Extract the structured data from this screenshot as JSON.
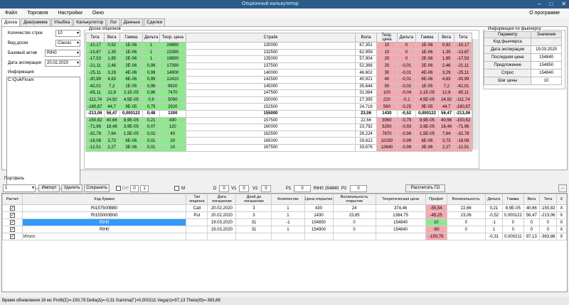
{
  "window": {
    "title": "Опционный калькулятор"
  },
  "menu": [
    "Файл",
    "Торговля",
    "Настройки",
    "Окно"
  ],
  "about": "О программе",
  "tabs": [
    "Доска",
    "Диаграмма",
    "Улыбка",
    "Калькулятор",
    "Лог",
    "Данные",
    "Сделки"
  ],
  "left": {
    "rows_label": "Количество строк",
    "rows_value": "10",
    "view_label": "Вид доски",
    "view_value": "Classic",
    "asset_label": "Базовый актив",
    "asset_value": "RIH0",
    "exp_label": "Дата экспирации",
    "exp_value": "20.02.2020",
    "info_label": "Информация",
    "info_text": "C:\\QuikFinam"
  },
  "board": {
    "title": "Доска опционов",
    "headers": [
      "Тета",
      "Вега",
      "Гамма",
      "Дельта",
      "Теор. цена",
      "Страйк",
      "Вола",
      "Теор. цена",
      "Дельта",
      "Гамма",
      "Вега",
      "Тета"
    ],
    "rows": [
      [
        "-10,17",
        "0,92",
        "1E-06",
        "1",
        "24880",
        "130000",
        "67,351",
        "10",
        "0",
        "1E-06",
        "0,92",
        "-10,17"
      ],
      [
        "-13,87",
        "1,35",
        "1E-06",
        "1",
        "22380",
        "132500",
        "62,959",
        "10",
        "0",
        "1E-06",
        "1,35",
        "-13,87"
      ],
      [
        "-17,53",
        "1,85",
        "2E-06",
        "1",
        "19890",
        "135000",
        "57,904",
        "20",
        "0",
        "2E-06",
        "1,85",
        "-17,53"
      ],
      [
        "-21,11",
        "2,46",
        "2E-06",
        "0,99",
        "17390",
        "137500",
        "52,366",
        "20",
        "-0,01",
        "2E-06",
        "2,46",
        "-21,11"
      ],
      [
        "-25,11",
        "3,29",
        "4E-06",
        "0,99",
        "14900",
        "140000",
        "46,602",
        "30",
        "-0,01",
        "4E-06",
        "3,29",
        "-25,11"
      ],
      [
        "-30,99",
        "4,63",
        "6E-06",
        "0,99",
        "12410",
        "142500",
        "40,921",
        "40",
        "-0,01",
        "6E-06",
        "4,63",
        "-30,99"
      ],
      [
        "-42,01",
        "7,2",
        "1E-05",
        "0,98",
        "9920",
        "145000",
        "35,644",
        "50",
        "-0,02",
        "1E-05",
        "7,2",
        "-42,01"
      ],
      [
        "-65,11",
        "12,8",
        "2,1E-05",
        "0,96",
        "7470",
        "147500",
        "31,064",
        "100",
        "-0,04",
        "2,1E-05",
        "12,8",
        "-65,11"
      ],
      [
        "-111,74",
        "24,92",
        "4,5E-05",
        "0,9",
        "5090",
        "150000",
        "27,395",
        "220",
        "-0,1",
        "4,5E-05",
        "24,92",
        "-111,74"
      ],
      [
        "-180,87",
        "44,7",
        "9E-05",
        "0,75",
        "2920",
        "152500",
        "24,719",
        "560",
        "-0,25",
        "9E-05",
        "44,7",
        "-180,87"
      ],
      [
        "-213,06",
        "56,47",
        "0,000122",
        "0,48",
        "1300",
        "155000",
        "23,06",
        "1430",
        "-0,52",
        "0,000122",
        "56,47",
        "-213,06"
      ],
      [
        "-150,82",
        "40,66",
        "8,9E-05",
        "0,21",
        "430",
        "157500",
        "22,66",
        "3060",
        "-0,79",
        "8,9E-05",
        "40,66",
        "-150,82"
      ],
      [
        "-71,96",
        "18,48",
        "3,9E-05",
        "0,07",
        "120",
        "160000",
        "23,792",
        "5250",
        "-0,93",
        "3,9E-05",
        "18,48",
        "-71,96"
      ],
      [
        "-32,78",
        "7,64",
        "1,5E-05",
        "0,02",
        "40",
        "162500",
        "26,224",
        "7670",
        "-0,98",
        "1,5E-05",
        "7,64",
        "-32,78"
      ],
      [
        "-18,08",
        "3,73",
        "6E-06",
        "0,01",
        "20",
        "165000",
        "29,622",
        "10150",
        "-0,99",
        "6E-06",
        "3,73",
        "-18,08"
      ],
      [
        "-12,51",
        "2,27",
        "3E-06",
        "0,01",
        "10",
        "167500",
        "33,676",
        "12640",
        "-0,99",
        "3E-06",
        "2,27",
        "-12,51"
      ]
    ]
  },
  "futures": {
    "title": "Информация по фьючерсу",
    "headers": [
      "Параметр",
      "Значение"
    ],
    "rows": [
      [
        "Код фьючерса",
        "RIH0"
      ],
      [
        "Дата экспирации",
        "19.03.2020"
      ],
      [
        "Последняя цена",
        "154840"
      ],
      [
        "Предложение",
        "154850"
      ],
      [
        "Спрос",
        "154840"
      ],
      [
        "Шаг цены",
        "10"
      ]
    ]
  },
  "portfolio": {
    "label": "Портфель",
    "select": "1",
    "buttons": {
      "import": "Импорт",
      "delete": "Удалить",
      "save": "Сохранить",
      "calc": "Рассчитать ГО",
      "more": "..."
    },
    "dh": "DH",
    "dh_v1": "0",
    "dh_v2": "1",
    "m": "M",
    "d_label": "D",
    "d": "0",
    "v1_label": "V1",
    "v1": "0",
    "v2_label": "V2",
    "v2": "0",
    "p1_label": "P1",
    "p1": "0",
    "p1_text": "RIH0 154840",
    "p2_label": "P2",
    "p2": "0",
    "headers": [
      "Расчет",
      "Код бумаги",
      "Тип опциона",
      "Дата погашения",
      "Дней до погашения",
      "Количество",
      "Цена открытия",
      "Волатильность открытия",
      "Теоретическая цена",
      "Профит",
      "Волатильность",
      "Дельта",
      "Гамма",
      "Вега",
      "Тета",
      "X"
    ],
    "rows": [
      [
        "✓",
        "RI157500BB0",
        "Call",
        "20.02.2020",
        "3",
        "1",
        "430",
        "24",
        "374,46",
        "-55,54",
        "22,66",
        "0,21",
        "8,9E-05",
        "40,66",
        "-150,82",
        "X"
      ],
      [
        "✓",
        "RI155000BN0",
        "Put",
        "20.02.2020",
        "3",
        "1",
        "1430",
        "23,85",
        "1384,75",
        "-45,25",
        "23,06",
        "-0,52",
        "0,000122",
        "56,47",
        "-213,06",
        "X"
      ],
      [
        "✓",
        "RIH0",
        "",
        "19.03.2020",
        "31",
        "-1",
        "154850",
        "0",
        "154840",
        "10",
        "0",
        "-1",
        "0",
        "0",
        "0",
        "X"
      ],
      [
        "✓",
        "RIH0",
        "",
        "19.03.2020",
        "31",
        "1",
        "154900",
        "0",
        "154840",
        "-60",
        "0",
        "1",
        "0",
        "0",
        "0",
        "X"
      ],
      [
        "✓",
        "Итого:",
        "",
        "",
        "",
        "",
        "",
        "",
        "",
        "-150,79",
        "",
        "-0,31",
        "0,000211",
        "97,13",
        "-363,88",
        "X"
      ]
    ]
  },
  "status": "Время обновления 16 мс  Profit(Σ)=-150,79 Delta(Δ)=-0,31 Gamma(Γ)=0,000211 Vega(ν)=97,13 Theta(Θ)=-363,88"
}
